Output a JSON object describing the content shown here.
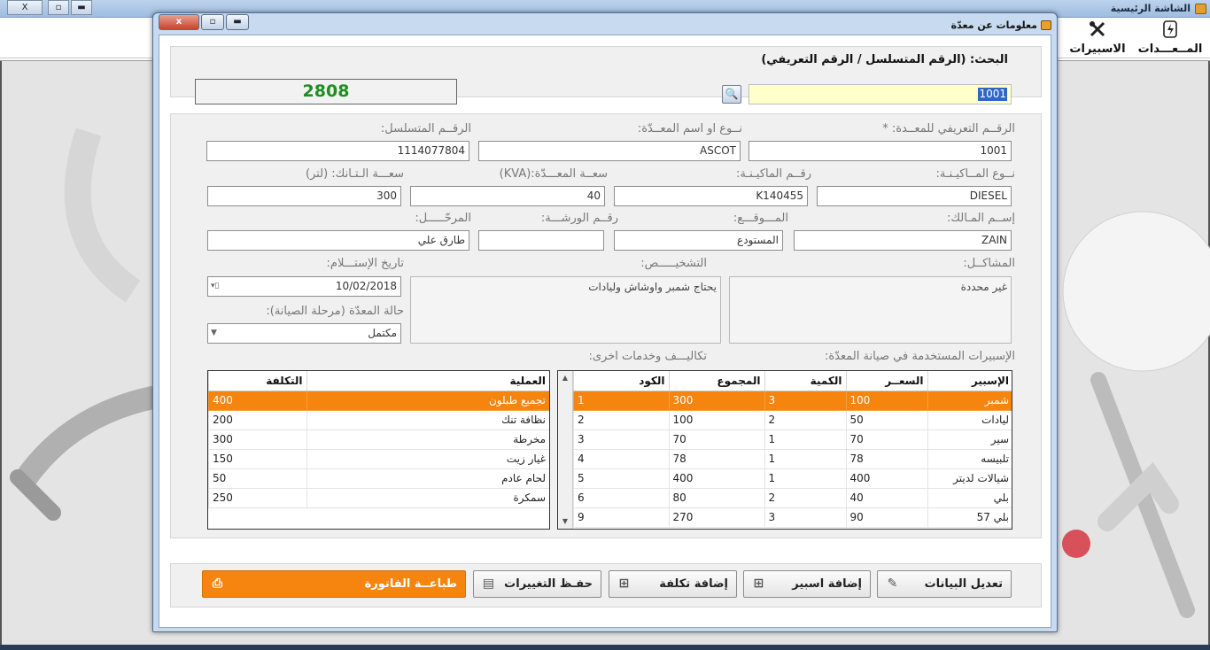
{
  "main_window": {
    "title": "الشاشة الرئيسية",
    "controls": {
      "close": "X",
      "restore": "▫",
      "minimize": "▬"
    },
    "toolbar": [
      {
        "label": "المــعـــدات",
        "icon": "device-icon"
      },
      {
        "label": "الاسبيرات",
        "icon": "tools-icon"
      }
    ]
  },
  "dialog": {
    "title": "معلومات عن معدّة",
    "controls": {
      "close": "x",
      "max": "▫",
      "min": "▬"
    },
    "search": {
      "label": "البحث: (الرقم المتسلسل / الرقم التعريفي)",
      "value": "1001",
      "button_icon": "🔍"
    },
    "counter": "2808",
    "form": {
      "id_label": "الرقــم التعريفي للمعــدة: *",
      "id_value": "1001",
      "type_label": "نــوع او اسم المعــدّة:",
      "type_value": "ASCOT",
      "serial_label": "الرقــم المتسلسل:",
      "serial_value": "1114077804",
      "machine_type_label": "نــوع المــاكيـنـة:",
      "machine_type_value": "DIESEL",
      "machine_no_label": "رقــم الماكيـنـة:",
      "machine_no_value": "K140455",
      "capacity_label": "سعــة المعـــدّة:(KVA)",
      "capacity_value": "40",
      "tank_label": "سعـــة الـتـانك: (لتر)",
      "tank_value": "300",
      "owner_label": "إســم المـالك:",
      "owner_value": "ZAIN",
      "location_label": "المـــوقـــع:",
      "location_value": "المستودع",
      "workshop_label": "رقــم الورشـــة:",
      "workshop_value": "",
      "stage_label": "المرحّـــــل:",
      "stage_value": "طارق علي",
      "problems_label": "المشاكــل:",
      "problems_value": "غير محددة",
      "diagnosis_label": "التشخيـــــص:",
      "diagnosis_value": "يحتاج شمبر واوشاش وليادات",
      "receive_date_label": "تاريخ الإستـــلام:",
      "receive_date_value": "10/02/2018",
      "status_label": "حالة المعدّة (مرحلة الصيانة):",
      "status_value": "مكتمل"
    },
    "parts_table": {
      "title": "الإسبيرات المستخدمة في صيانة المعدّة:",
      "columns": [
        "الإسبير",
        "السعــر",
        "الكمية",
        "المجموع",
        "الكود"
      ],
      "rows": [
        [
          "شمبر",
          "100",
          "3",
          "300",
          "1"
        ],
        [
          "ليادات",
          "50",
          "2",
          "100",
          "2"
        ],
        [
          "سير",
          "70",
          "1",
          "70",
          "3"
        ],
        [
          "تلبيسه",
          "78",
          "1",
          "78",
          "4"
        ],
        [
          "شيالات لديتر",
          "400",
          "1",
          "400",
          "5"
        ],
        [
          "بلي",
          "40",
          "2",
          "80",
          "6"
        ],
        [
          "بلي 57",
          "90",
          "3",
          "270",
          "9"
        ]
      ]
    },
    "costs_table": {
      "title": "تكاليـــف وخدمات اخرى:",
      "columns": [
        "العملية",
        "التكلفة"
      ],
      "rows": [
        [
          "تجميع طبلون",
          "400"
        ],
        [
          "نظافة تنك",
          "200"
        ],
        [
          "مخرطة",
          "300"
        ],
        [
          "غيار زيت",
          "150"
        ],
        [
          "لحام عادم",
          "50"
        ],
        [
          "سمكرة",
          "250"
        ]
      ]
    },
    "buttons": {
      "edit": "تعديل البيانات",
      "add_part": "إضافة اسبير",
      "add_cost": "إضافة تكلفة",
      "save": "حفـظ التغييرات",
      "print": "طباعــة الفاتورة"
    }
  },
  "colors": {
    "accent": "#f5850f",
    "counter": "#1f8f1f",
    "search_bg": "#ffffcc",
    "titlebar": "#c8daf0"
  }
}
